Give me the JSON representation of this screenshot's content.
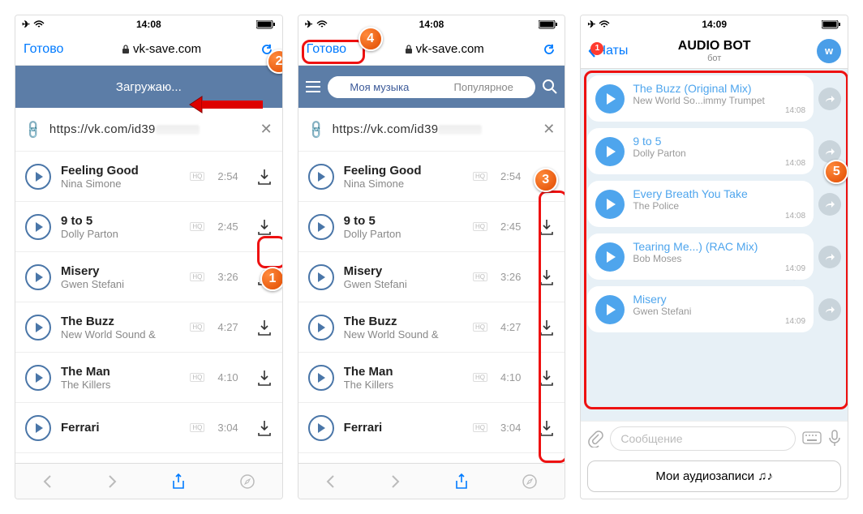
{
  "status": {
    "time": "14:08",
    "time3": "14:09"
  },
  "nav": {
    "done": "Готово",
    "domain": "vk-save.com"
  },
  "toolbar": {
    "loading": "Загружаю..."
  },
  "tabs": {
    "mymusic": "Моя музыка",
    "popular": "Популярное"
  },
  "url": {
    "text": "https://vk.com/id39"
  },
  "hq": "HQ",
  "tracks": [
    {
      "title": "Feeling Good",
      "artist": "Nina Simone",
      "dur": "2:54"
    },
    {
      "title": "9 to 5",
      "artist": "Dolly Parton",
      "dur": "2:45"
    },
    {
      "title": "Misery",
      "artist": "Gwen Stefani",
      "dur": "3:26"
    },
    {
      "title": "The Buzz",
      "artist": "New World Sound &",
      "dur": "4:27"
    },
    {
      "title": "The Man",
      "artist": "The Killers",
      "dur": "4:10"
    },
    {
      "title": "Ferrari",
      "artist": "",
      "dur": "3:04"
    }
  ],
  "tg": {
    "back": "Чаты",
    "badge": "1",
    "title": "AUDIO BOT",
    "sub": "бот",
    "vk": "w",
    "tracks": [
      {
        "title": "The Buzz (Original Mix)",
        "artist": "New World So...immy Trumpet",
        "time": "14:08"
      },
      {
        "title": "9 to 5",
        "artist": "Dolly Parton",
        "time": "14:08"
      },
      {
        "title": "Every Breath You Take",
        "artist": "The Police",
        "time": "14:08"
      },
      {
        "title": "Tearing Me...) (RAC Mix)",
        "artist": "Bob Moses",
        "time": "14:09"
      },
      {
        "title": "Misery",
        "artist": "Gwen Stefani",
        "time": "14:09"
      }
    ],
    "placeholder": "Сообщение",
    "button": "Мои аудиозаписи ♫♪"
  }
}
